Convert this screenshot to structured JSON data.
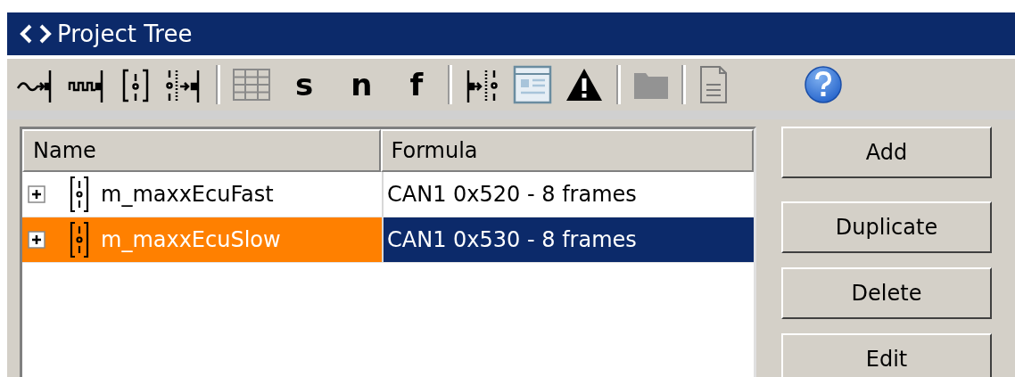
{
  "window": {
    "title": "Project Tree"
  },
  "toolbar": [
    {
      "kind": "wave-in"
    },
    {
      "kind": "pulse-in"
    },
    {
      "kind": "bits"
    },
    {
      "kind": "bits-in"
    },
    {
      "kind": "separator"
    },
    {
      "kind": "table"
    },
    {
      "kind": "letter",
      "label": "s"
    },
    {
      "kind": "letter",
      "label": "n"
    },
    {
      "kind": "letter",
      "label": "f"
    },
    {
      "kind": "separator"
    },
    {
      "kind": "bits-out"
    },
    {
      "kind": "window"
    },
    {
      "kind": "warning"
    },
    {
      "kind": "separator"
    },
    {
      "kind": "folder"
    },
    {
      "kind": "separator"
    },
    {
      "kind": "document"
    },
    {
      "kind": "help"
    }
  ],
  "table": {
    "columns": [
      "Name",
      "Formula"
    ],
    "rows": [
      {
        "name": "m_maxxEcuFast",
        "formula": "CAN1 0x520 - 8 frames",
        "expanded": false,
        "selected": false
      },
      {
        "name": "m_maxxEcuSlow",
        "formula": "CAN1 0x530 - 8 frames",
        "expanded": false,
        "selected": true
      }
    ]
  },
  "buttons": [
    "Add",
    "Duplicate",
    "Delete",
    "Edit"
  ]
}
